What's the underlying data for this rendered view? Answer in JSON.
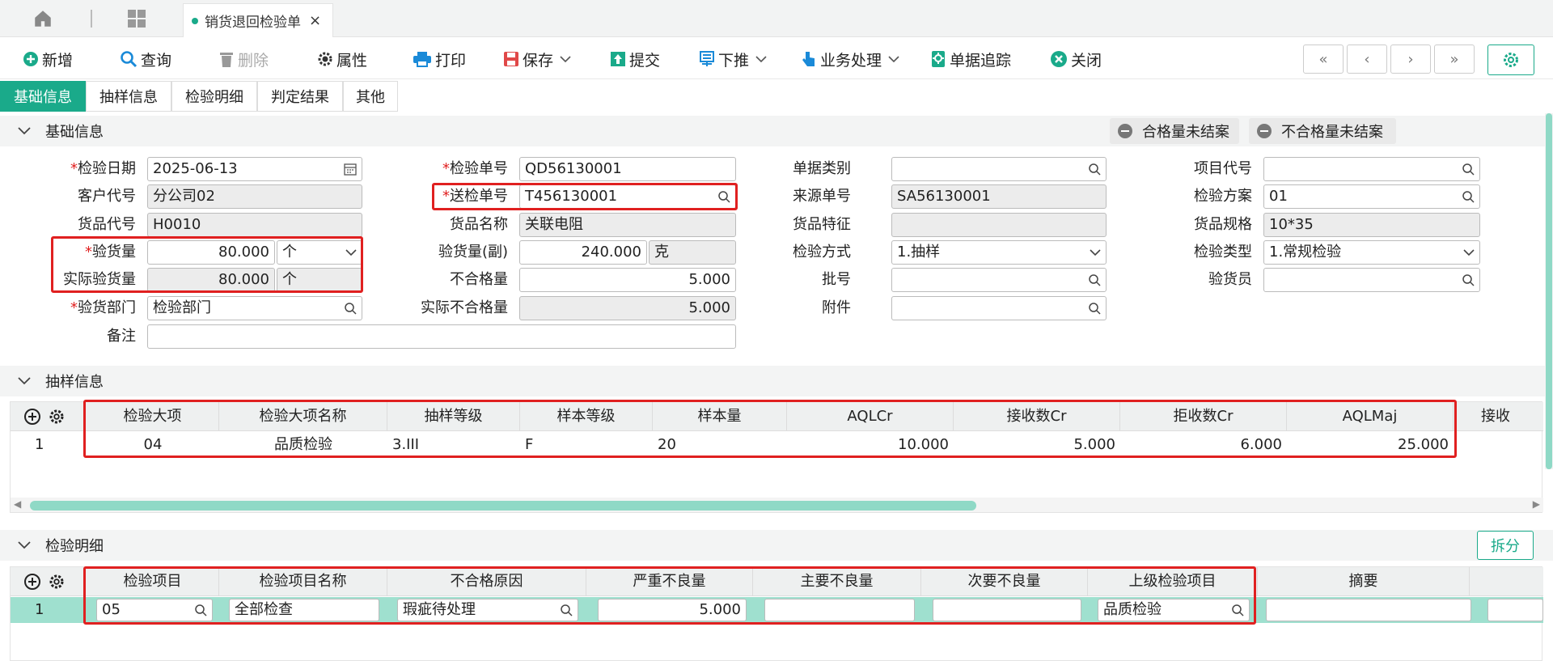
{
  "colors": {
    "accent": "#1aaa8a",
    "required": "#e02020",
    "highlight": "#e02020"
  },
  "window_tab": {
    "title": "销货退回检验单",
    "close": "×"
  },
  "toolbar": {
    "new": "新增",
    "query": "查询",
    "delete": "删除",
    "props": "属性",
    "print": "打印",
    "save": "保存",
    "submit": "提交",
    "push": "下推",
    "business": "业务处理",
    "trace": "单据追踪",
    "close": "关闭"
  },
  "subtabs": [
    "基础信息",
    "抽样信息",
    "检验明细",
    "判定结果",
    "其他"
  ],
  "basic": {
    "section_title": "基础信息",
    "pills": [
      "合格量未结案",
      "不合格量未结案"
    ],
    "fields": {
      "inspect_date": {
        "label": "检验日期",
        "value": "2025-06-13"
      },
      "customer": {
        "label": "客户代号",
        "value": "分公司02"
      },
      "item_code": {
        "label": "货品代号",
        "value": "H0010"
      },
      "inspect_qty": {
        "label": "验货量",
        "value": "80.000",
        "unit": "个"
      },
      "actual_qty": {
        "label": "实际验货量",
        "value": "80.000",
        "unit": "个"
      },
      "dept": {
        "label": "验货部门",
        "value": "检验部门"
      },
      "remark": {
        "label": "备注",
        "value": ""
      },
      "inspect_no": {
        "label": "检验单号",
        "value": "QD56130001"
      },
      "send_no": {
        "label": "送检单号",
        "value": "T456130001"
      },
      "item_name": {
        "label": "货品名称",
        "value": "关联电阻"
      },
      "qty_sub": {
        "label": "验货量(副)",
        "value": "240.000",
        "unit": "克"
      },
      "defect_qty": {
        "label": "不合格量",
        "value": "5.000"
      },
      "actual_defect": {
        "label": "实际不合格量",
        "value": "5.000"
      },
      "doc_type": {
        "label": "单据类别",
        "value": ""
      },
      "source_no": {
        "label": "来源单号",
        "value": "SA56130001"
      },
      "item_feature": {
        "label": "货品特征",
        "value": ""
      },
      "method": {
        "label": "检验方式",
        "value": "1.抽样"
      },
      "batch": {
        "label": "批号",
        "value": ""
      },
      "attach": {
        "label": "附件",
        "value": ""
      },
      "project": {
        "label": "项目代号",
        "value": ""
      },
      "scheme": {
        "label": "检验方案",
        "value": "01"
      },
      "spec": {
        "label": "货品规格",
        "value": "10*35"
      },
      "type": {
        "label": "检验类型",
        "value": "1.常规检验"
      },
      "inspector": {
        "label": "验货员",
        "value": ""
      }
    }
  },
  "sampling": {
    "section_title": "抽样信息",
    "columns": [
      "检验大项",
      "检验大项名称",
      "抽样等级",
      "样本等级",
      "样本量",
      "AQLCr",
      "接收数Cr",
      "拒收数Cr",
      "AQLMaj",
      "接收"
    ],
    "rows": [
      {
        "no": "1",
        "cells": [
          "04",
          "品质检验",
          "3.III",
          "F",
          "20",
          "10.000",
          "5.000",
          "6.000",
          "25.000"
        ]
      }
    ]
  },
  "detail": {
    "section_title": "检验明细",
    "split": "拆分",
    "columns": [
      "检验项目",
      "检验项目名称",
      "不合格原因",
      "严重不良量",
      "主要不良量",
      "次要不良量",
      "上级检验项目",
      "摘要"
    ],
    "rows": [
      {
        "no": "1",
        "cells": [
          "05",
          "全部检查",
          "瑕疵待处理",
          "5.000",
          "",
          "",
          "品质检验",
          ""
        ]
      }
    ]
  }
}
